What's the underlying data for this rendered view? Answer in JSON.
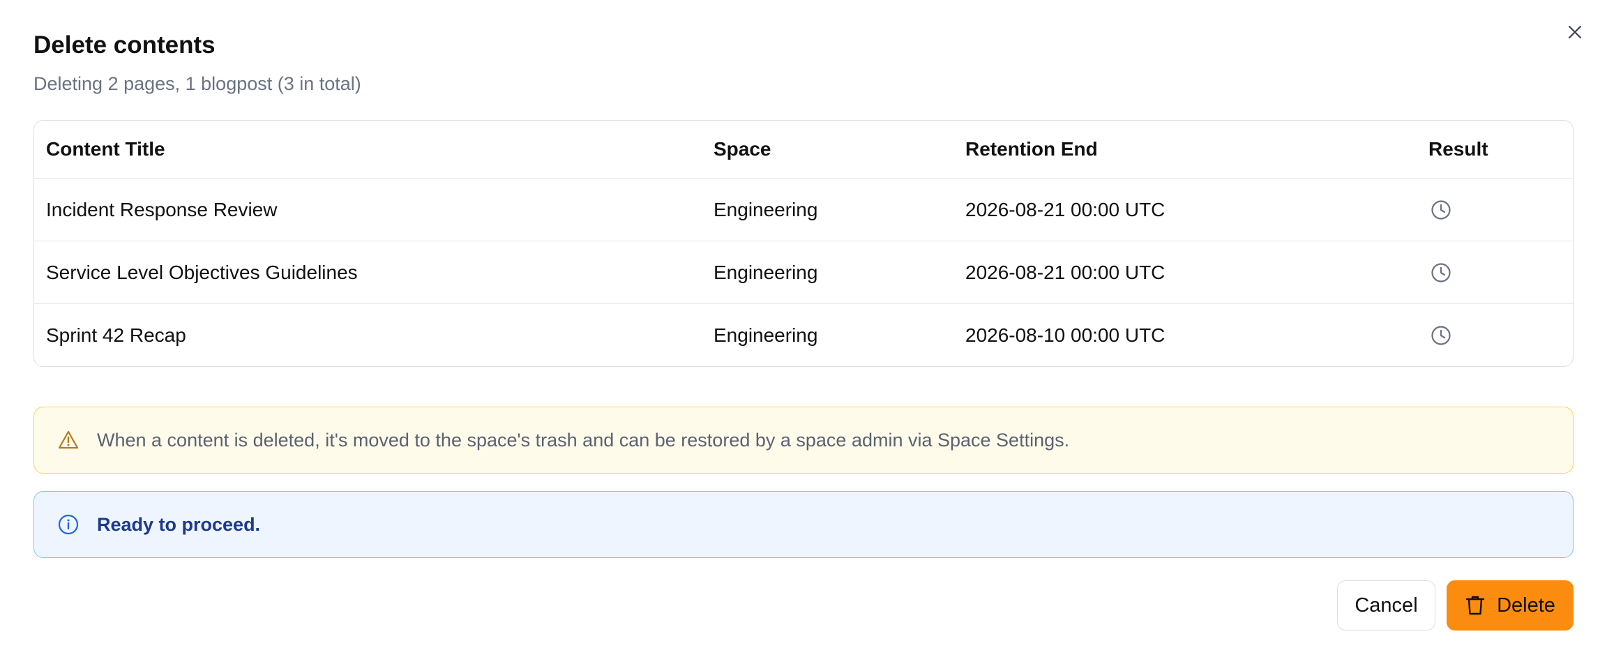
{
  "dialog": {
    "title": "Delete contents",
    "subtitle": "Deleting 2 pages, 1 blogpost (3 in total)"
  },
  "table": {
    "columns": [
      "Content Title",
      "Space",
      "Retention End",
      "Result"
    ],
    "rows": [
      {
        "title": "Incident Response Review",
        "space": "Engineering",
        "retention_end": "2026-08-21 00:00 UTC",
        "result_icon": "clock-icon"
      },
      {
        "title": "Service Level Objectives Guidelines",
        "space": "Engineering",
        "retention_end": "2026-08-21 00:00 UTC",
        "result_icon": "clock-icon"
      },
      {
        "title": "Sprint 42 Recap",
        "space": "Engineering",
        "retention_end": "2026-08-10 00:00 UTC",
        "result_icon": "clock-icon"
      }
    ]
  },
  "warning": {
    "icon": "warning-triangle-icon",
    "text": "When a content is deleted, it's moved to the space's trash and can be restored by a space admin via Space Settings."
  },
  "info": {
    "icon": "info-circle-icon",
    "text": "Ready to proceed."
  },
  "actions": {
    "cancel_label": "Cancel",
    "delete_label": "Delete",
    "delete_icon": "trash-icon"
  },
  "colors": {
    "delete_button": "#fb8c0f",
    "warning_bg": "#fffbea",
    "warning_border": "#f0d468",
    "info_bg": "#eef5ff",
    "info_border": "#93bdf1",
    "info_text": "#1e3a8a"
  }
}
